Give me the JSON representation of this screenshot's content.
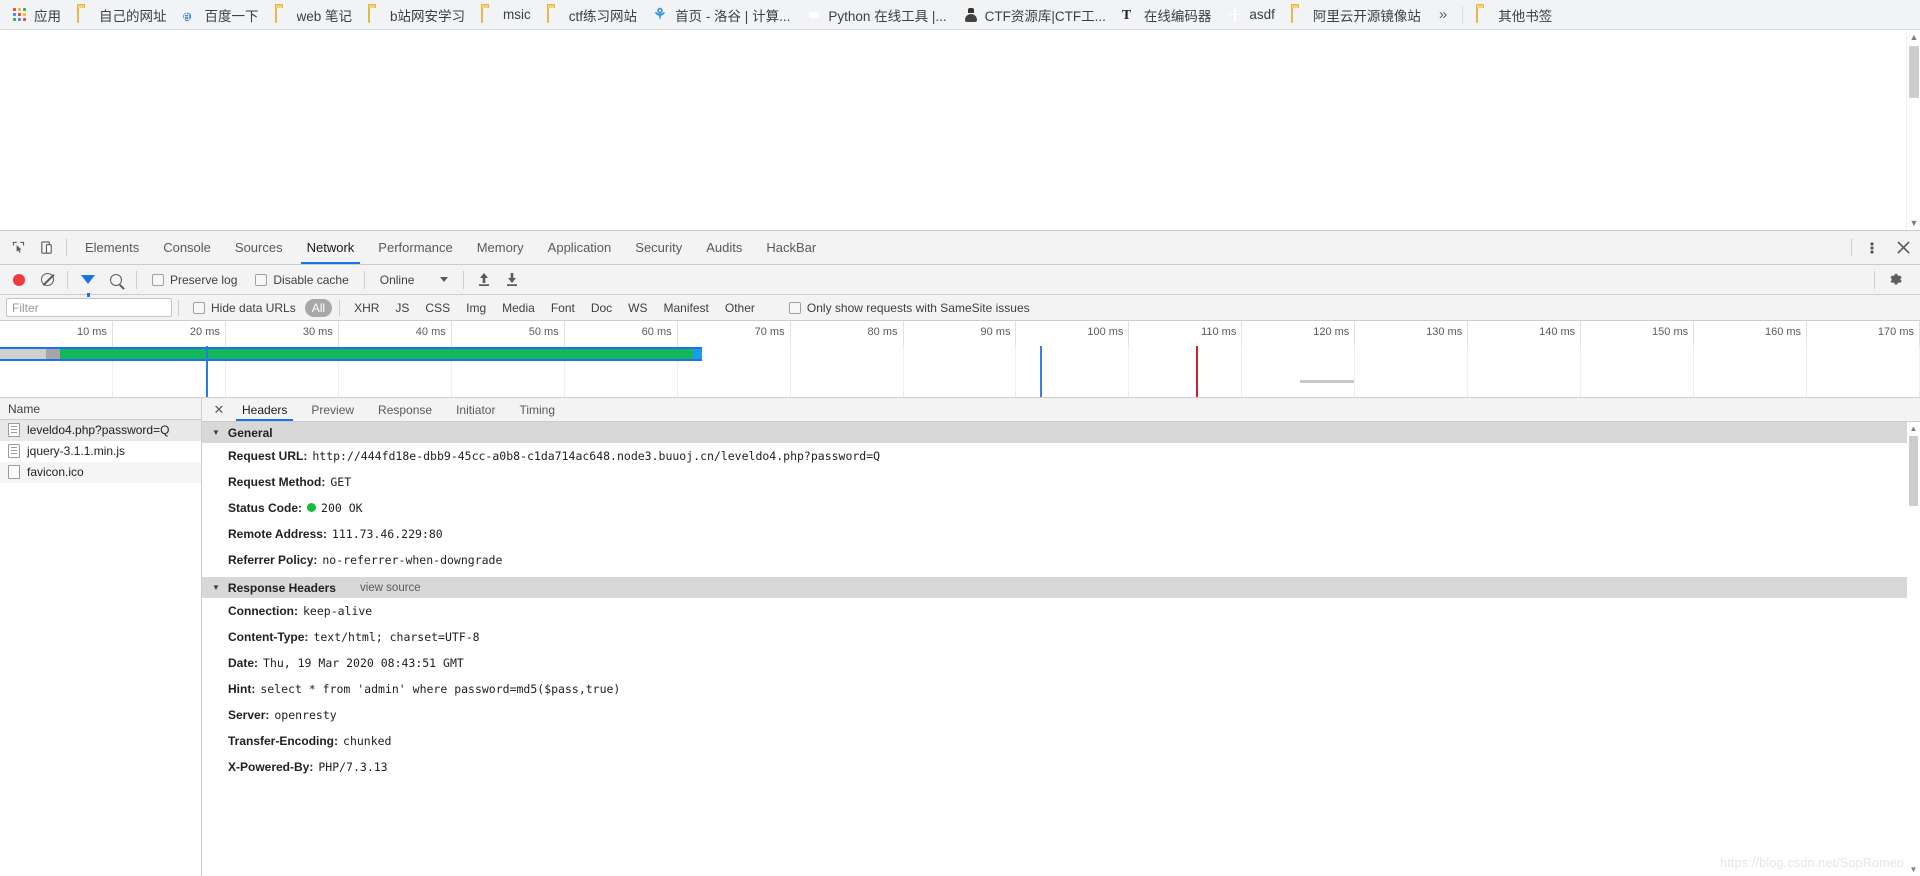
{
  "bookmarks": {
    "apps_label": "应用",
    "items": [
      {
        "label": "自己的网址",
        "icon": "folder-icon"
      },
      {
        "label": "百度一下",
        "icon": "baidu-icon"
      },
      {
        "label": "web 笔记",
        "icon": "folder-icon"
      },
      {
        "label": "b站网安学习",
        "icon": "folder-icon"
      },
      {
        "label": "msic",
        "icon": "folder-icon"
      },
      {
        "label": "ctf练习网站",
        "icon": "folder-icon"
      },
      {
        "label": "首页 - 洛谷 | 计算...",
        "icon": "luogu-icon"
      },
      {
        "label": "Python 在线工具 |...",
        "icon": "python-icon"
      },
      {
        "label": "CTF资源库|CTF工...",
        "icon": "ctf-icon"
      },
      {
        "label": "在线编码器",
        "icon": "text-tool-icon"
      },
      {
        "label": "asdf",
        "icon": "globe-icon"
      },
      {
        "label": "阿里云开源镜像站",
        "icon": "folder-icon"
      }
    ],
    "overflow_label": "»",
    "other_bookmarks": {
      "label": "其他书签",
      "icon": "folder-icon"
    }
  },
  "devtools": {
    "tabs": [
      {
        "label": "Elements",
        "active": false
      },
      {
        "label": "Console",
        "active": false
      },
      {
        "label": "Sources",
        "active": false
      },
      {
        "label": "Network",
        "active": true
      },
      {
        "label": "Performance",
        "active": false
      },
      {
        "label": "Memory",
        "active": false
      },
      {
        "label": "Application",
        "active": false
      },
      {
        "label": "Security",
        "active": false
      },
      {
        "label": "Audits",
        "active": false
      },
      {
        "label": "HackBar",
        "active": false
      }
    ],
    "toolbar": {
      "record_title": "record-button",
      "clear_title": "clear-button",
      "filter_title": "filter-toggle",
      "search_title": "search-button",
      "preserve_log": "Preserve log",
      "disable_cache": "Disable cache",
      "throttling": "Online",
      "import_title": "import-har",
      "export_title": "export-har",
      "settings_title": "settings"
    },
    "filterbar": {
      "filter_placeholder": "Filter",
      "filter_value": "",
      "hide_data_urls": "Hide data URLs",
      "types": [
        "All",
        "XHR",
        "JS",
        "CSS",
        "Img",
        "Media",
        "Font",
        "Doc",
        "WS",
        "Manifest",
        "Other"
      ],
      "selected_type": "All",
      "samesite_label": "Only show requests with SameSite issues"
    },
    "timeline": {
      "ticks": [
        "10 ms",
        "20 ms",
        "30 ms",
        "40 ms",
        "50 ms",
        "60 ms",
        "70 ms",
        "80 ms",
        "90 ms",
        "100 ms",
        "110 ms",
        "120 ms",
        "130 ms",
        "140 ms",
        "150 ms",
        "160 ms",
        "170 ms"
      ]
    },
    "requests": {
      "column_name": "Name",
      "rows": [
        {
          "name": "leveldo4.php?password=Q",
          "icon": "document-icon",
          "selected": true
        },
        {
          "name": "jquery-3.1.1.min.js",
          "icon": "document-icon",
          "selected": false
        },
        {
          "name": "favicon.ico",
          "icon": "file-icon",
          "selected": false
        }
      ]
    },
    "detail": {
      "tabs": [
        {
          "label": "Headers",
          "active": true
        },
        {
          "label": "Preview",
          "active": false
        },
        {
          "label": "Response",
          "active": false
        },
        {
          "label": "Initiator",
          "active": false
        },
        {
          "label": "Timing",
          "active": false
        }
      ],
      "general": {
        "title": "General",
        "rows": [
          {
            "name": "Request URL:",
            "value": "http://444fd18e-dbb9-45cc-a0b8-c1da714ac648.node3.buuoj.cn/leveldo4.php?password=Q"
          },
          {
            "name": "Request Method:",
            "value": "GET"
          },
          {
            "name": "Status Code:",
            "value": "200 OK",
            "status_dot": "#11bb3b"
          },
          {
            "name": "Remote Address:",
            "value": "111.73.46.229:80"
          },
          {
            "name": "Referrer Policy:",
            "value": "no-referrer-when-downgrade"
          }
        ]
      },
      "response_headers": {
        "title": "Response Headers",
        "view_source": "view source",
        "rows": [
          {
            "name": "Connection:",
            "value": "keep-alive"
          },
          {
            "name": "Content-Type:",
            "value": "text/html; charset=UTF-8"
          },
          {
            "name": "Date:",
            "value": "Thu, 19 Mar 2020 08:43:51 GMT"
          },
          {
            "name": "Hint:",
            "value": "select * from 'admin' where password=md5($pass,true)"
          },
          {
            "name": "Server:",
            "value": "openresty"
          },
          {
            "name": "Transfer-Encoding:",
            "value": "chunked"
          },
          {
            "name": "X-Powered-By:",
            "value": "PHP/7.3.13"
          }
        ]
      }
    }
  },
  "watermark": "https://blog.csdn.net/SopRomeo"
}
